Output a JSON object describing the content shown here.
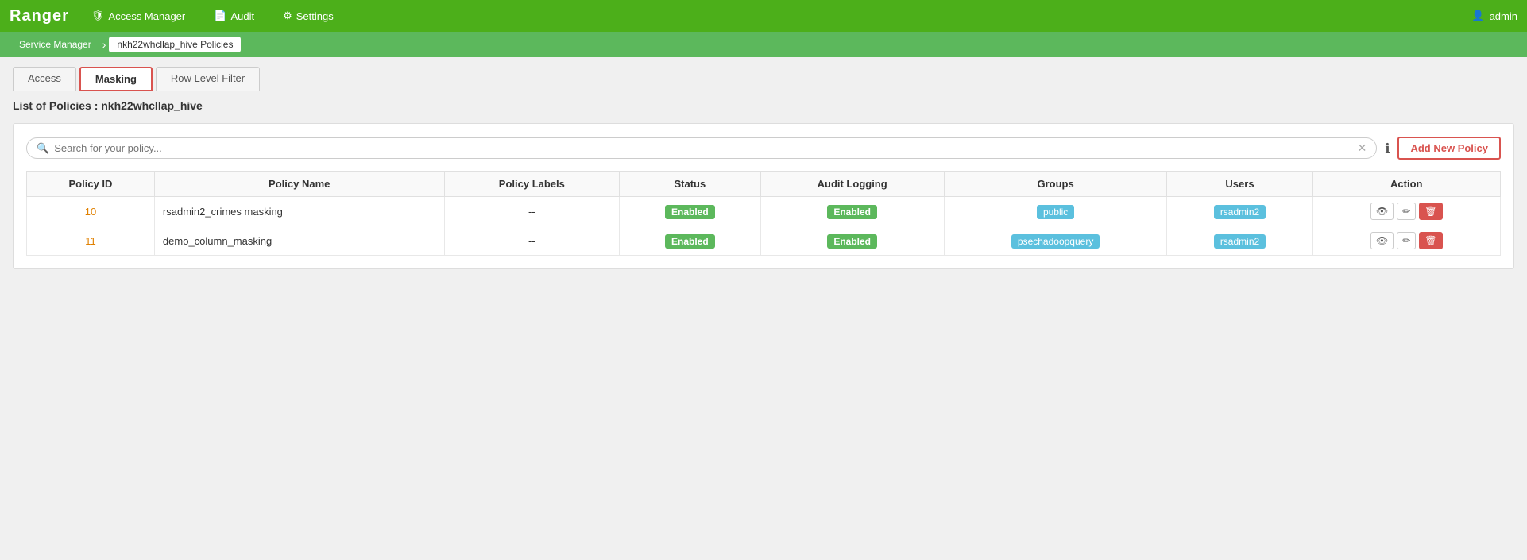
{
  "brand": "Ranger",
  "navbar": {
    "items": [
      {
        "id": "access-manager",
        "label": "Access Manager",
        "icon": "shield"
      },
      {
        "id": "audit",
        "label": "Audit",
        "icon": "file"
      },
      {
        "id": "settings",
        "label": "Settings",
        "icon": "gear"
      }
    ],
    "user": "admin",
    "user_icon": "person"
  },
  "breadcrumb": {
    "items": [
      {
        "id": "service-manager",
        "label": "Service Manager",
        "active": false
      },
      {
        "id": "policy-breadcrumb",
        "label": "nkh22whcllap_hive Policies",
        "active": true
      }
    ]
  },
  "tabs": [
    {
      "id": "access",
      "label": "Access",
      "active": false
    },
    {
      "id": "masking",
      "label": "Masking",
      "active": true
    },
    {
      "id": "row-level-filter",
      "label": "Row Level Filter",
      "active": false
    }
  ],
  "page_title": "List of Policies : nkh22whcllap_hive",
  "search": {
    "placeholder": "Search for your policy...",
    "value": ""
  },
  "add_policy_button": "Add New Policy",
  "table": {
    "columns": [
      "Policy ID",
      "Policy Name",
      "Policy Labels",
      "Status",
      "Audit Logging",
      "Groups",
      "Users",
      "Action"
    ],
    "rows": [
      {
        "id": "10",
        "name": "rsadmin2_crimes masking",
        "labels": "--",
        "status": "Enabled",
        "audit_logging": "Enabled",
        "groups": "public",
        "users": "rsadmin2"
      },
      {
        "id": "11",
        "name": "demo_column_masking",
        "labels": "--",
        "status": "Enabled",
        "audit_logging": "Enabled",
        "groups": "psechadoopquery",
        "users": "rsadmin2"
      }
    ]
  }
}
